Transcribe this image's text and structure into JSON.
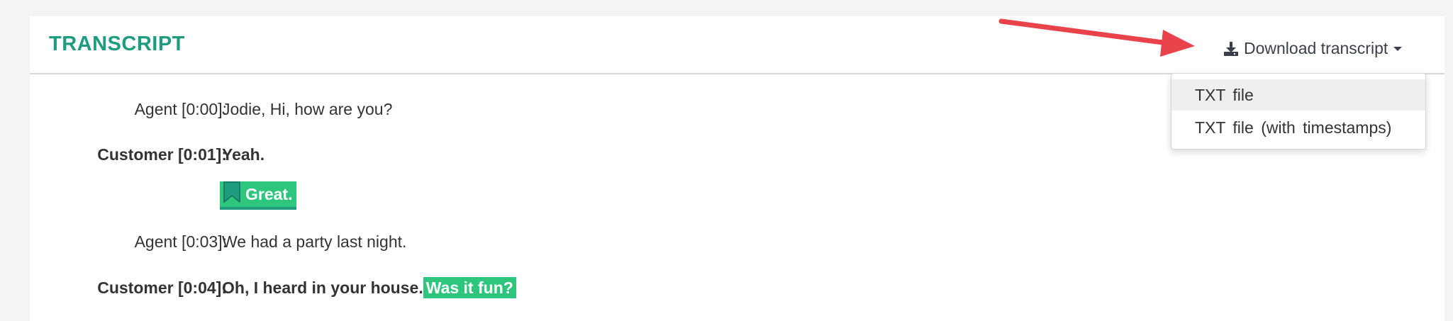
{
  "panel": {
    "title": "TRANSCRIPT",
    "download_label": "Download transcript"
  },
  "dropdown": {
    "items": [
      {
        "label": "TXT file"
      },
      {
        "label": "TXT file (with timestamps)"
      }
    ]
  },
  "transcript": [
    {
      "speaker": "Agent [0:00]:",
      "text": "Jodie, Hi, how are you?"
    },
    {
      "speaker": "Customer [0:01]:",
      "text": "Yeah."
    },
    {
      "bookmark_text": "Great."
    },
    {
      "speaker": "Agent [0:03]:",
      "text": "We had a party last night."
    },
    {
      "speaker": "Customer [0:04]:",
      "text": "Oh, I heard in your house.",
      "highlight": "Was it fun?"
    }
  ],
  "colors": {
    "accent": "#1f9c7f",
    "highlight": "#2ec57d",
    "arrow": "#e8424a"
  },
  "icons": [
    "download-icon",
    "caret-down-icon",
    "bookmark-icon",
    "annotation-arrow"
  ]
}
